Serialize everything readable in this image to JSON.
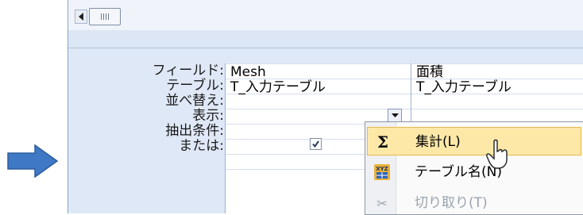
{
  "colors": {
    "arrow": "#3f78c5",
    "window_bg": "#dfe8f6",
    "menu_hover": "#fde8a8"
  },
  "query_grid": {
    "row_labels": [
      "フィールド:",
      "テーブル:",
      "並べ替え:",
      "表示:",
      "抽出条件:",
      "または:"
    ],
    "columns": [
      {
        "field": "Mesh",
        "table": "T_入力テーブル",
        "show_checked": true
      },
      {
        "field": "面積",
        "table": "T_入力テーブル"
      }
    ]
  },
  "context_menu": {
    "items": [
      {
        "label": "集計(L)",
        "icon": "sigma-icon",
        "glyph": "Σ",
        "highlighted": true
      },
      {
        "label": "テーブル名(N)",
        "icon": "table-names-icon",
        "glyph": "XYZ"
      },
      {
        "label": "切り取り(T)",
        "icon": "cut-icon",
        "glyph": "✂",
        "disabled": true
      }
    ]
  },
  "icons": {
    "arrow": "right-arrow-icon",
    "scroll_left": "scroll-left-icon",
    "dropdown": "chevron-down-icon",
    "cursor": "mouse-pointer-icon"
  }
}
